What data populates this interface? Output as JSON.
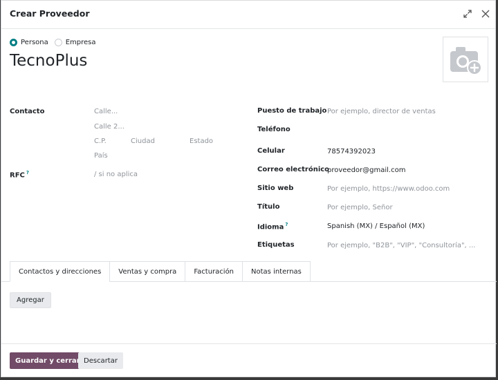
{
  "dialog": {
    "title": "Crear Proveedor"
  },
  "company_type": {
    "options": [
      "Persona",
      "Empresa"
    ],
    "selected": "Persona"
  },
  "partner": {
    "name": "TecnoPlus"
  },
  "address": {
    "label": "Contacto",
    "street_placeholder": "Calle...",
    "street2_placeholder": "Calle 2...",
    "zip_placeholder": "C.P.",
    "city_placeholder": "Ciudad",
    "state_placeholder": "Estado",
    "country_placeholder": "País"
  },
  "rfc": {
    "label": "RFC",
    "help": "?",
    "placeholder": "/ si no aplica"
  },
  "right_fields": {
    "job": {
      "label": "Puesto de trabajo",
      "placeholder": "Por ejemplo, director de ventas"
    },
    "phone": {
      "label": "Teléfono",
      "value": ""
    },
    "mobile": {
      "label": "Celular",
      "value": "78574392023"
    },
    "email": {
      "label": "Correo electrónico",
      "value": "proveedor@gmail.com"
    },
    "website": {
      "label": "Sitio web",
      "placeholder": "Por ejemplo, https://www.odoo.com"
    },
    "title": {
      "label": "Título",
      "placeholder": "Por ejemplo, Señor"
    },
    "language": {
      "label": "Idioma",
      "help": "?",
      "value": "Spanish (MX) / Español (MX)"
    },
    "tags": {
      "label": "Etiquetas",
      "placeholder": "Por ejemplo, \"B2B\", \"VIP\", \"Consultoría\", ..."
    }
  },
  "tabs": [
    "Contactos y direcciones",
    "Ventas y compra",
    "Facturación",
    "Notas internas"
  ],
  "active_tab": "Contactos y direcciones",
  "buttons": {
    "add": "Agregar",
    "save_close": "Guardar y cerrar",
    "discard": "Descartar"
  },
  "colors": {
    "primary": "#714b67",
    "accent": "#017e84"
  }
}
